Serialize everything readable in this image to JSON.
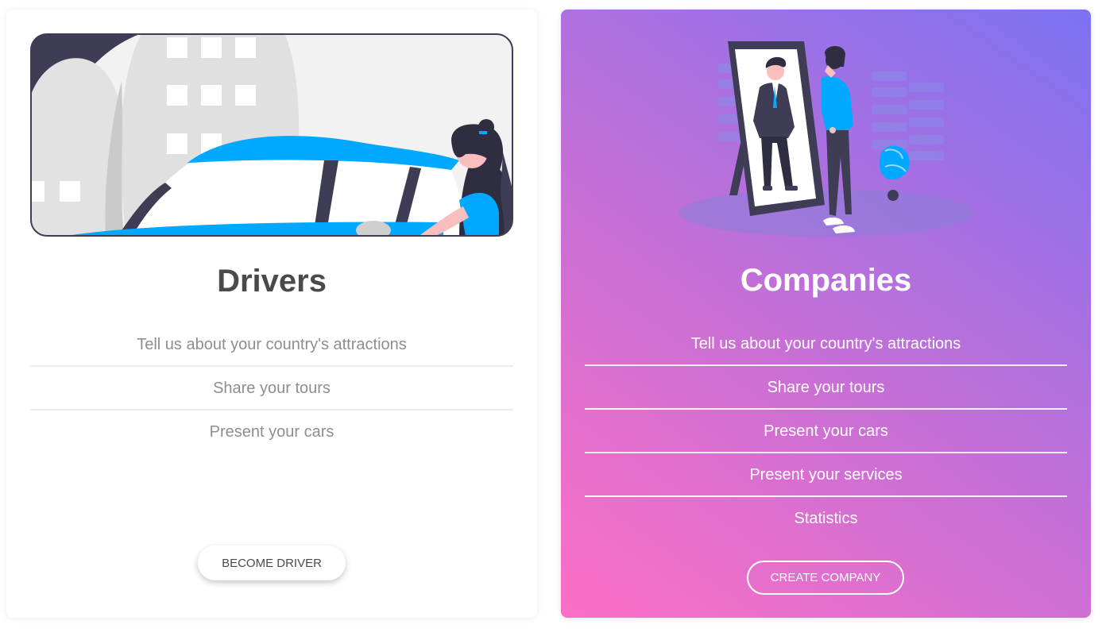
{
  "drivers": {
    "title": "Drivers",
    "features": [
      "Tell us about your country's attractions",
      "Share your tours",
      "Present your cars"
    ],
    "button_label": "BECOME DRIVER"
  },
  "companies": {
    "title": "Companies",
    "features": [
      "Tell us about your country's attractions",
      "Share your tours",
      "Present your cars",
      "Present your services",
      "Statistics"
    ],
    "button_label": "CREATE COMPANY"
  },
  "colors": {
    "accent_blue": "#00a8ff",
    "gradient_pink": "#fd6fc5",
    "gradient_violet": "#7c72f2",
    "title_gray": "#4a4a4a",
    "feature_gray": "#8e8e8e"
  },
  "illustrations": {
    "drivers": "woman-driving-car-illustration",
    "companies": "man-looking-in-mirror-illustration"
  }
}
